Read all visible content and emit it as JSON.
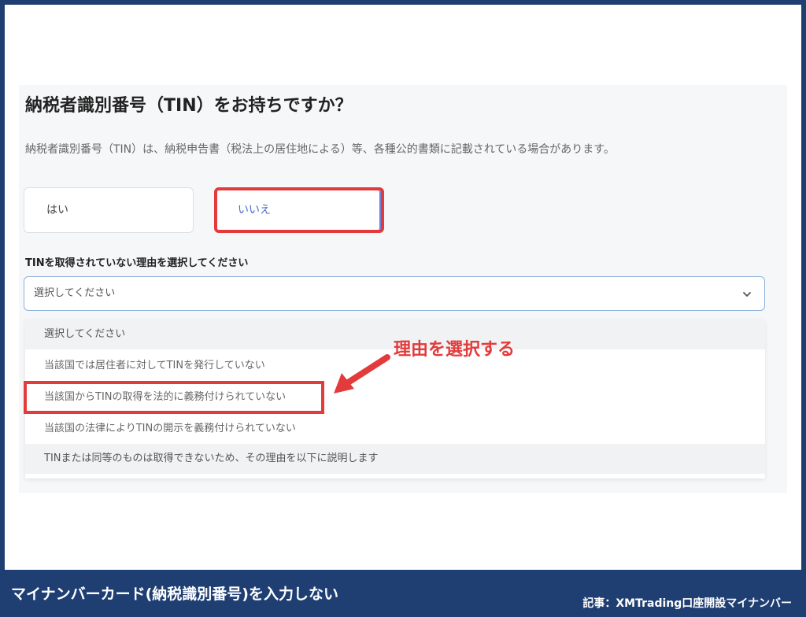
{
  "form": {
    "title": "納税者識別番号（TIN）をお持ちですか？",
    "description": "納税者識別番号（TIN）は、納税申告書（税法上の居住地による）等、各種公的書類に記載されている場合があります。",
    "options": [
      {
        "label": "はい"
      },
      {
        "label": "いいえ",
        "selected": true
      }
    ],
    "reason_label": "TINを取得されていない理由を選択してください",
    "select": {
      "value": "選択してください",
      "icon": "chevron-down-icon"
    },
    "dropdown_items": [
      "選択してください",
      "当該国では居住者に対してTINを発行していない",
      "当該国からTINの取得を法的に義務付けられていない",
      "当該国の法律によりTINの開示を義務付けられていない",
      "TINまたは同等のものは取得できないため、その理由を以下に説明します"
    ]
  },
  "annotation": {
    "text": "理由を選択する",
    "color": "#e33b3b"
  },
  "footer": {
    "left": "マイナンバーカード(納税識別番号)を入力しない",
    "right": "記事：XMTrading口座開設マイナンバー",
    "background": "#1f3f73"
  }
}
